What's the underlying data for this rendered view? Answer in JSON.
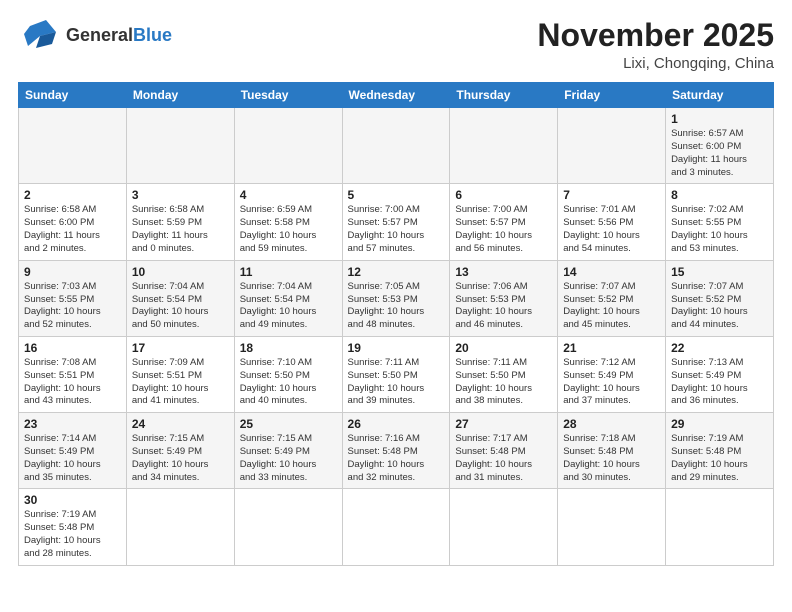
{
  "header": {
    "logo_general": "General",
    "logo_blue": "Blue",
    "month": "November 2025",
    "location": "Lixi, Chongqing, China"
  },
  "weekdays": [
    "Sunday",
    "Monday",
    "Tuesday",
    "Wednesday",
    "Thursday",
    "Friday",
    "Saturday"
  ],
  "weeks": [
    [
      {
        "day": "",
        "info": ""
      },
      {
        "day": "",
        "info": ""
      },
      {
        "day": "",
        "info": ""
      },
      {
        "day": "",
        "info": ""
      },
      {
        "day": "",
        "info": ""
      },
      {
        "day": "",
        "info": ""
      },
      {
        "day": "1",
        "info": "Sunrise: 6:57 AM\nSunset: 6:00 PM\nDaylight: 11 hours\nand 3 minutes."
      }
    ],
    [
      {
        "day": "2",
        "info": "Sunrise: 6:58 AM\nSunset: 6:00 PM\nDaylight: 11 hours\nand 2 minutes."
      },
      {
        "day": "3",
        "info": "Sunrise: 6:58 AM\nSunset: 5:59 PM\nDaylight: 11 hours\nand 0 minutes."
      },
      {
        "day": "4",
        "info": "Sunrise: 6:59 AM\nSunset: 5:58 PM\nDaylight: 10 hours\nand 59 minutes."
      },
      {
        "day": "5",
        "info": "Sunrise: 7:00 AM\nSunset: 5:57 PM\nDaylight: 10 hours\nand 57 minutes."
      },
      {
        "day": "6",
        "info": "Sunrise: 7:00 AM\nSunset: 5:57 PM\nDaylight: 10 hours\nand 56 minutes."
      },
      {
        "day": "7",
        "info": "Sunrise: 7:01 AM\nSunset: 5:56 PM\nDaylight: 10 hours\nand 54 minutes."
      },
      {
        "day": "8",
        "info": "Sunrise: 7:02 AM\nSunset: 5:55 PM\nDaylight: 10 hours\nand 53 minutes."
      }
    ],
    [
      {
        "day": "9",
        "info": "Sunrise: 7:03 AM\nSunset: 5:55 PM\nDaylight: 10 hours\nand 52 minutes."
      },
      {
        "day": "10",
        "info": "Sunrise: 7:04 AM\nSunset: 5:54 PM\nDaylight: 10 hours\nand 50 minutes."
      },
      {
        "day": "11",
        "info": "Sunrise: 7:04 AM\nSunset: 5:54 PM\nDaylight: 10 hours\nand 49 minutes."
      },
      {
        "day": "12",
        "info": "Sunrise: 7:05 AM\nSunset: 5:53 PM\nDaylight: 10 hours\nand 48 minutes."
      },
      {
        "day": "13",
        "info": "Sunrise: 7:06 AM\nSunset: 5:53 PM\nDaylight: 10 hours\nand 46 minutes."
      },
      {
        "day": "14",
        "info": "Sunrise: 7:07 AM\nSunset: 5:52 PM\nDaylight: 10 hours\nand 45 minutes."
      },
      {
        "day": "15",
        "info": "Sunrise: 7:07 AM\nSunset: 5:52 PM\nDaylight: 10 hours\nand 44 minutes."
      }
    ],
    [
      {
        "day": "16",
        "info": "Sunrise: 7:08 AM\nSunset: 5:51 PM\nDaylight: 10 hours\nand 43 minutes."
      },
      {
        "day": "17",
        "info": "Sunrise: 7:09 AM\nSunset: 5:51 PM\nDaylight: 10 hours\nand 41 minutes."
      },
      {
        "day": "18",
        "info": "Sunrise: 7:10 AM\nSunset: 5:50 PM\nDaylight: 10 hours\nand 40 minutes."
      },
      {
        "day": "19",
        "info": "Sunrise: 7:11 AM\nSunset: 5:50 PM\nDaylight: 10 hours\nand 39 minutes."
      },
      {
        "day": "20",
        "info": "Sunrise: 7:11 AM\nSunset: 5:50 PM\nDaylight: 10 hours\nand 38 minutes."
      },
      {
        "day": "21",
        "info": "Sunrise: 7:12 AM\nSunset: 5:49 PM\nDaylight: 10 hours\nand 37 minutes."
      },
      {
        "day": "22",
        "info": "Sunrise: 7:13 AM\nSunset: 5:49 PM\nDaylight: 10 hours\nand 36 minutes."
      }
    ],
    [
      {
        "day": "23",
        "info": "Sunrise: 7:14 AM\nSunset: 5:49 PM\nDaylight: 10 hours\nand 35 minutes."
      },
      {
        "day": "24",
        "info": "Sunrise: 7:15 AM\nSunset: 5:49 PM\nDaylight: 10 hours\nand 34 minutes."
      },
      {
        "day": "25",
        "info": "Sunrise: 7:15 AM\nSunset: 5:49 PM\nDaylight: 10 hours\nand 33 minutes."
      },
      {
        "day": "26",
        "info": "Sunrise: 7:16 AM\nSunset: 5:48 PM\nDaylight: 10 hours\nand 32 minutes."
      },
      {
        "day": "27",
        "info": "Sunrise: 7:17 AM\nSunset: 5:48 PM\nDaylight: 10 hours\nand 31 minutes."
      },
      {
        "day": "28",
        "info": "Sunrise: 7:18 AM\nSunset: 5:48 PM\nDaylight: 10 hours\nand 30 minutes."
      },
      {
        "day": "29",
        "info": "Sunrise: 7:19 AM\nSunset: 5:48 PM\nDaylight: 10 hours\nand 29 minutes."
      }
    ],
    [
      {
        "day": "30",
        "info": "Sunrise: 7:19 AM\nSunset: 5:48 PM\nDaylight: 10 hours\nand 28 minutes."
      },
      {
        "day": "",
        "info": ""
      },
      {
        "day": "",
        "info": ""
      },
      {
        "day": "",
        "info": ""
      },
      {
        "day": "",
        "info": ""
      },
      {
        "day": "",
        "info": ""
      },
      {
        "day": "",
        "info": ""
      }
    ]
  ]
}
